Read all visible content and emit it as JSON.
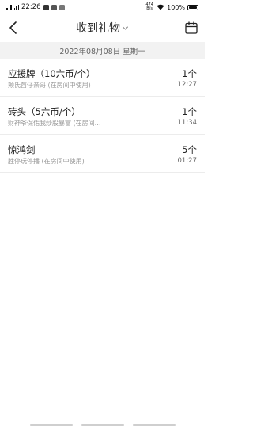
{
  "status_bar": {
    "time": "22:26",
    "net_speed": "474 B/s",
    "battery": "100%"
  },
  "header": {
    "title": "收到礼物"
  },
  "date_bar": {
    "date": "2022年08月08日 星期一"
  },
  "gifts": [
    {
      "name": "应援牌（10六币/个）",
      "sub": "颠氏茴仔亲哥 (在房间中使用)",
      "qty": "1个",
      "time": "12:27"
    },
    {
      "name": "砖头（5六币/个）",
      "sub": "财神爷保佑我炒股暴富 (在房间…",
      "qty": "1个",
      "time": "11:34"
    },
    {
      "name": "惊鸿剑",
      "sub": "胜停玩停播 (在房间中使用)",
      "qty": "5个",
      "time": "01:27"
    }
  ]
}
